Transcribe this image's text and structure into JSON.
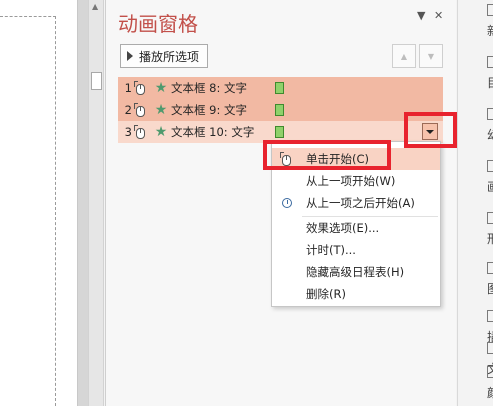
{
  "pane": {
    "title": "动画窗格",
    "dropdown_glyph": "▼",
    "close_glyph": "✕",
    "play_label": "播放所选项",
    "move_up_glyph": "▲",
    "move_down_glyph": "▼"
  },
  "animations": [
    {
      "number": "1",
      "label": "文本框 8: 文字"
    },
    {
      "number": "2",
      "label": "文本框 9: 文字"
    },
    {
      "number": "3",
      "label": "文本框 10: 文字"
    }
  ],
  "menu": {
    "items": [
      {
        "label": "单击开始(C)",
        "icon": "mouse-icon"
      },
      {
        "label": "从上一项开始(W)",
        "icon": ""
      },
      {
        "label": "从上一项之后开始(A)",
        "icon": "clock-icon"
      },
      {
        "label": "效果选项(E)...",
        "icon": ""
      },
      {
        "label": "计时(T)...",
        "icon": ""
      },
      {
        "label": "隐藏高级日程表(H)",
        "icon": ""
      },
      {
        "label": "删除(R)",
        "icon": ""
      }
    ]
  },
  "ribbon": {
    "items": [
      "新",
      "目",
      "幻",
      "画",
      "形",
      "图",
      "插",
      "文",
      "颜"
    ]
  },
  "colors": {
    "title": "#c2504a",
    "selected_row": "#f2b9a3",
    "highlight": "#e8232e",
    "timing_bar": "#8fd16a",
    "star": "#4f9a6e"
  }
}
